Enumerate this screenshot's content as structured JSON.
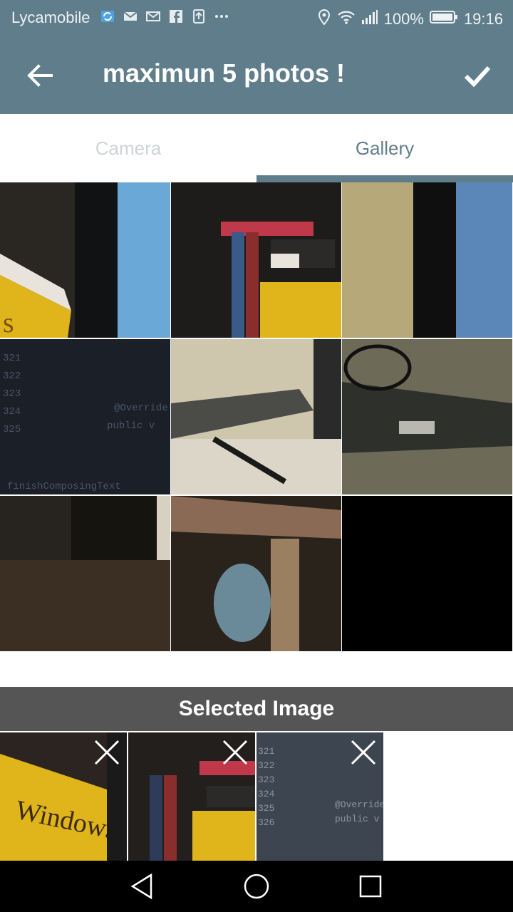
{
  "status_bar": {
    "carrier": "Lycamobile",
    "battery": "100%",
    "time": "19:16",
    "notification_icons": [
      "sync-icon",
      "mail-icon",
      "gmail-icon",
      "facebook-icon",
      "upload-icon",
      "more-icon"
    ],
    "right_icons": [
      "location-icon",
      "wifi-icon",
      "signal-icon",
      "battery-icon"
    ]
  },
  "toolbar": {
    "title": "maximun 5 photos !",
    "back_icon": "arrow-left-icon",
    "done_icon": "checkmark-icon"
  },
  "tabs": [
    {
      "label": "Camera",
      "active": false
    },
    {
      "label": "Gallery",
      "active": true
    }
  ],
  "gallery": {
    "rows": 3,
    "columns": 3,
    "items": [
      {
        "desc": "photo",
        "color": "#2a2622"
      },
      {
        "desc": "photo",
        "color": "#1e1c1b"
      },
      {
        "desc": "photo",
        "color": "#b7a87a"
      },
      {
        "desc": "photo",
        "color": "#1a1f28"
      },
      {
        "desc": "photo",
        "color": "#3a3832"
      },
      {
        "desc": "photo",
        "color": "#2e302c"
      },
      {
        "desc": "photo",
        "color": "#27231f"
      },
      {
        "desc": "photo",
        "color": "#2a231c"
      },
      {
        "desc": "photo",
        "color": "#000000"
      }
    ]
  },
  "selected": {
    "header": "Selected Image",
    "items": [
      {
        "desc": "selected photo",
        "color": "#2b2420"
      },
      {
        "desc": "selected photo",
        "color": "#221f1d"
      },
      {
        "desc": "selected photo",
        "color": "#3d4650"
      }
    ],
    "remove_icon": "close-icon"
  },
  "nav_bar": {
    "icons": [
      "back-triangle-icon",
      "home-circle-icon",
      "recents-square-icon"
    ]
  },
  "colors": {
    "primary": "#607d8b",
    "header_dark": "#555555",
    "tab_inactive": "#cfd4d7"
  }
}
